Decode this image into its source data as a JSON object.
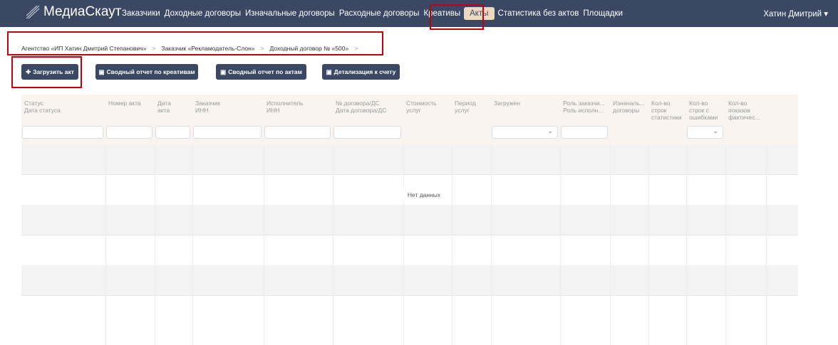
{
  "nav": {
    "brand": "МедиаСкаут",
    "items": [
      "Заказчики",
      "Доходные договоры",
      "Изначальные договоры",
      "Расходные договоры",
      "Креативы",
      "Акты",
      "Статистика без актов",
      "Площадки"
    ],
    "active": "Акты",
    "user": "Хатин Дмитрий ▾"
  },
  "breadcrumb": [
    "Агентство «ИП Хатин Дмитрий Степанович»",
    "Заказчик «Рекламодатель-Слон»",
    "Доходный договор № «500»"
  ],
  "breadcrumb_sep": ">",
  "buttons": {
    "upload": "Загрузить акт",
    "creatives_report": "Сводный отчет по креативам",
    "acts_report": "Сводный отчет по актам",
    "invoice_detail": "Детализация к счету"
  },
  "columns": [
    [
      "Статус",
      "Дата статуса"
    ],
    [
      "Номер акта"
    ],
    [
      "Дата",
      "акта"
    ],
    [
      "Заказчик",
      "ИНН"
    ],
    [
      "Исполнитель",
      "ИНН"
    ],
    [
      "№ договора/ДС",
      "Дата договора/ДС"
    ],
    [
      "Стоимость",
      "услуг"
    ],
    [
      "Период",
      "услуг"
    ],
    [
      "Загружен"
    ],
    [
      "Роль заказчи...",
      "Роль исполн..."
    ],
    [
      "Изначаль...",
      "договоры"
    ],
    [
      "Кол-во",
      "строк",
      "статистики"
    ],
    [
      "Кол-во",
      "строк с",
      "ошибками"
    ],
    [
      "Кол-во",
      "показов",
      "фактичес..."
    ],
    []
  ],
  "empty_text": "Нет данных",
  "colors": {
    "nav": "#3b4863",
    "active_tab": "#ecd9bf",
    "header_bg": "#f9f4ef",
    "annotation": "#c4000d"
  }
}
